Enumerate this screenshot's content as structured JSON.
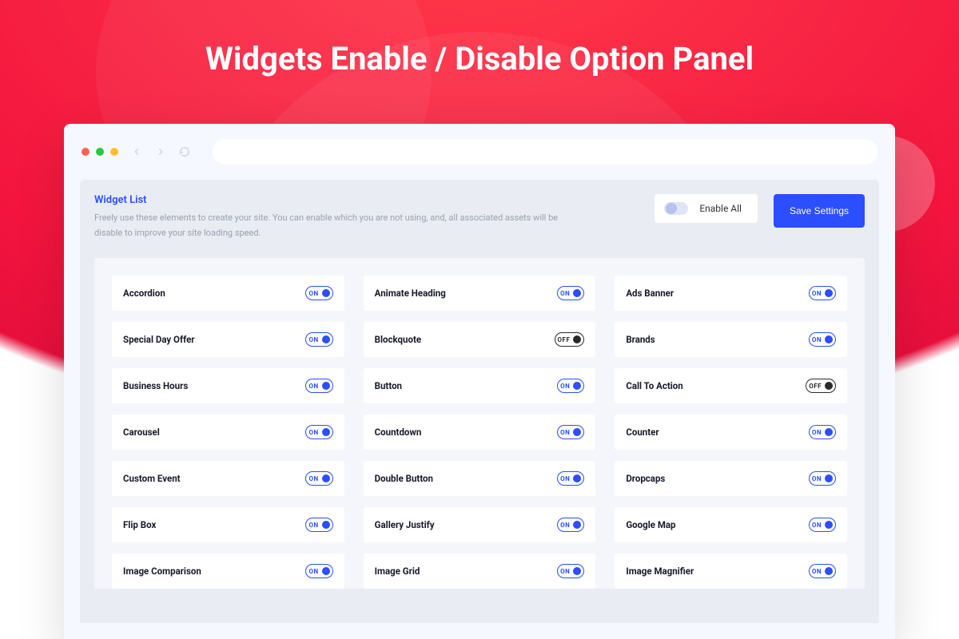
{
  "page_title": "Widgets Enable / Disable Option Panel",
  "panel": {
    "title": "Widget List",
    "description": "Freely use these elements to create your site. You can enable which you are not using, and, all associated assets will be disable to improve your site loading speed.",
    "enable_all_label": "Enable All",
    "save_label": "Save Settings",
    "on_text": "ON",
    "off_text": "OFF"
  },
  "widgets": [
    {
      "name": "Accordion",
      "state": "on"
    },
    {
      "name": "Animate Heading",
      "state": "on"
    },
    {
      "name": "Ads Banner",
      "state": "on"
    },
    {
      "name": "Special Day Offer",
      "state": "on"
    },
    {
      "name": "Blockquote",
      "state": "off"
    },
    {
      "name": "Brands",
      "state": "on"
    },
    {
      "name": "Business Hours",
      "state": "on"
    },
    {
      "name": "Button",
      "state": "on"
    },
    {
      "name": "Call To Action",
      "state": "off"
    },
    {
      "name": "Carousel",
      "state": "on"
    },
    {
      "name": "Countdown",
      "state": "on"
    },
    {
      "name": "Counter",
      "state": "on"
    },
    {
      "name": "Custom Event",
      "state": "on"
    },
    {
      "name": "Double Button",
      "state": "on"
    },
    {
      "name": "Dropcaps",
      "state": "on"
    },
    {
      "name": "Flip Box",
      "state": "on"
    },
    {
      "name": "Gallery Justify",
      "state": "on"
    },
    {
      "name": "Google Map",
      "state": "on"
    },
    {
      "name": "Image Comparison",
      "state": "on"
    },
    {
      "name": "Image Grid",
      "state": "on"
    },
    {
      "name": "Image Magnifier",
      "state": "on"
    }
  ]
}
